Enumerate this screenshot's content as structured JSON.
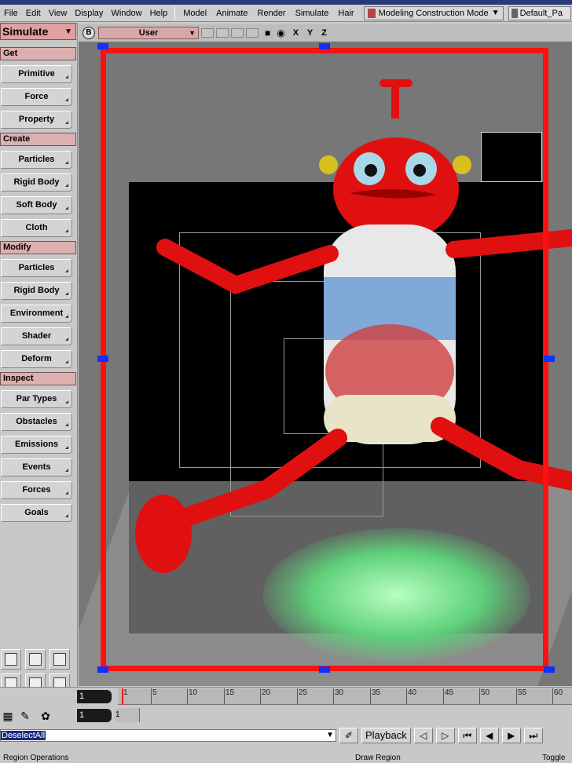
{
  "menubar": {
    "menus": [
      "File",
      "Edit",
      "View",
      "Display",
      "Window",
      "Help"
    ],
    "modules": [
      "Model",
      "Animate",
      "Render",
      "Simulate",
      "Hair"
    ],
    "mode": "Modeling Construction Mode",
    "default_field": "Default_Pa"
  },
  "left_panel": {
    "header": "Simulate",
    "sections": {
      "get": "Get",
      "create": "Create",
      "modify": "Modify",
      "inspect": "Inspect"
    },
    "get_items": [
      "Primitive",
      "Force",
      "Property"
    ],
    "create_items": [
      "Particles",
      "Rigid Body",
      "Soft Body",
      "Cloth"
    ],
    "modify_items": [
      "Particles",
      "Rigid Body",
      "Environment",
      "Shader",
      "Deform"
    ],
    "inspect_items": [
      "Par Types",
      "Obstacles",
      "Emissions",
      "Events",
      "Forces",
      "Goals"
    ]
  },
  "viewport": {
    "badge": "B",
    "view_name": "User",
    "axes": "X Y Z"
  },
  "timeline": {
    "current_frame": "1",
    "start_frame": "1",
    "range_value": "1",
    "ticks": [
      "1",
      "5",
      "10",
      "15",
      "20",
      "25",
      "30",
      "35",
      "40",
      "45",
      "50",
      "55",
      "60"
    ]
  },
  "command_bar": {
    "command_text": "DeselectAll",
    "playback_label": "Playback"
  },
  "status": {
    "left": "Region Operations",
    "middle": "Draw Region",
    "right": "Toggle"
  }
}
